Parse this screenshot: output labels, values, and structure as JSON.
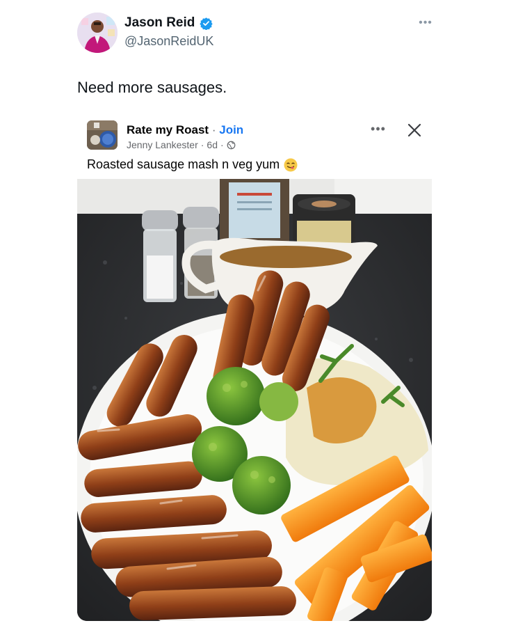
{
  "tweet": {
    "author_name": "Jason Reid",
    "author_handle": "@JasonReidUK",
    "text": "Need more sausages."
  },
  "embedded_post": {
    "group_name": "Rate my Roast",
    "separator": "·",
    "join_label": "Join",
    "poster_name": "Jenny Lankester",
    "time_ago": "6d",
    "caption": "Roasted sausage mash n veg yum"
  },
  "icons": {
    "verified": "verified-badge-icon",
    "more_top": "more-options-icon",
    "globe": "globe-icon",
    "fb_more": "more-options-icon",
    "close": "close-icon",
    "emoji": "yum-face-emoji"
  },
  "colors": {
    "verified_blue": "#1d9bf0",
    "join_blue": "#1877f2",
    "handle_gray": "#536471",
    "meta_gray": "#65676b"
  }
}
